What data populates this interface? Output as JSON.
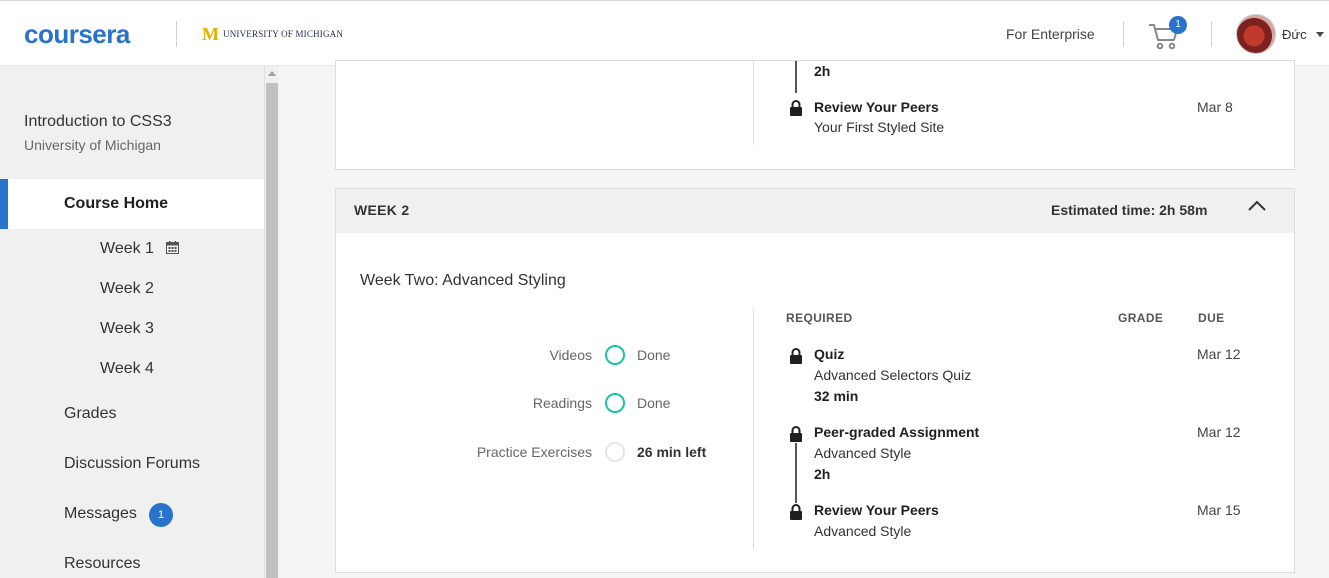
{
  "header": {
    "logo": "coursera",
    "partner_mark": "M",
    "partner_name": "UNIVERSITY OF MICHIGAN",
    "enterprise_link": "For Enterprise",
    "cart_count": "1",
    "username": "Đức",
    "accent_color": "#2a73cc"
  },
  "sidebar": {
    "course_title": "Introduction to CSS3",
    "course_university": "University of Michigan",
    "home_label": "Course Home",
    "weeks": [
      "Week 1",
      "Week 2",
      "Week 3",
      "Week 4"
    ],
    "grades_label": "Grades",
    "forums_label": "Discussion Forums",
    "messages_label": "Messages",
    "messages_count": "1",
    "resources_label": "Resources"
  },
  "prev_week": {
    "duration": "2h",
    "item": {
      "type": "Review Your Peers",
      "name": "Your First Styled Site",
      "due": "Mar 8"
    }
  },
  "week2": {
    "label": "WEEK 2",
    "estimated_time": "Estimated time: 2h 58m",
    "title": "Week Two: Advanced Styling",
    "progress": [
      {
        "label": "Videos",
        "status": "Done"
      },
      {
        "label": "Readings",
        "status": "Done"
      },
      {
        "label": "Practice Exercises",
        "status": "26 min left"
      }
    ],
    "columns": {
      "required": "REQUIRED",
      "grade": "GRADE",
      "due": "DUE"
    },
    "items": [
      {
        "type": "Quiz",
        "name": "Advanced Selectors Quiz",
        "duration": "32 min",
        "due": "Mar 12"
      },
      {
        "type": "Peer-graded Assignment",
        "name": "Advanced Style",
        "duration": "2h",
        "due": "Mar 12"
      },
      {
        "type": "Review Your Peers",
        "name": "Advanced Style",
        "due": "Mar 15"
      }
    ],
    "done_color": "#1bc3a2"
  }
}
